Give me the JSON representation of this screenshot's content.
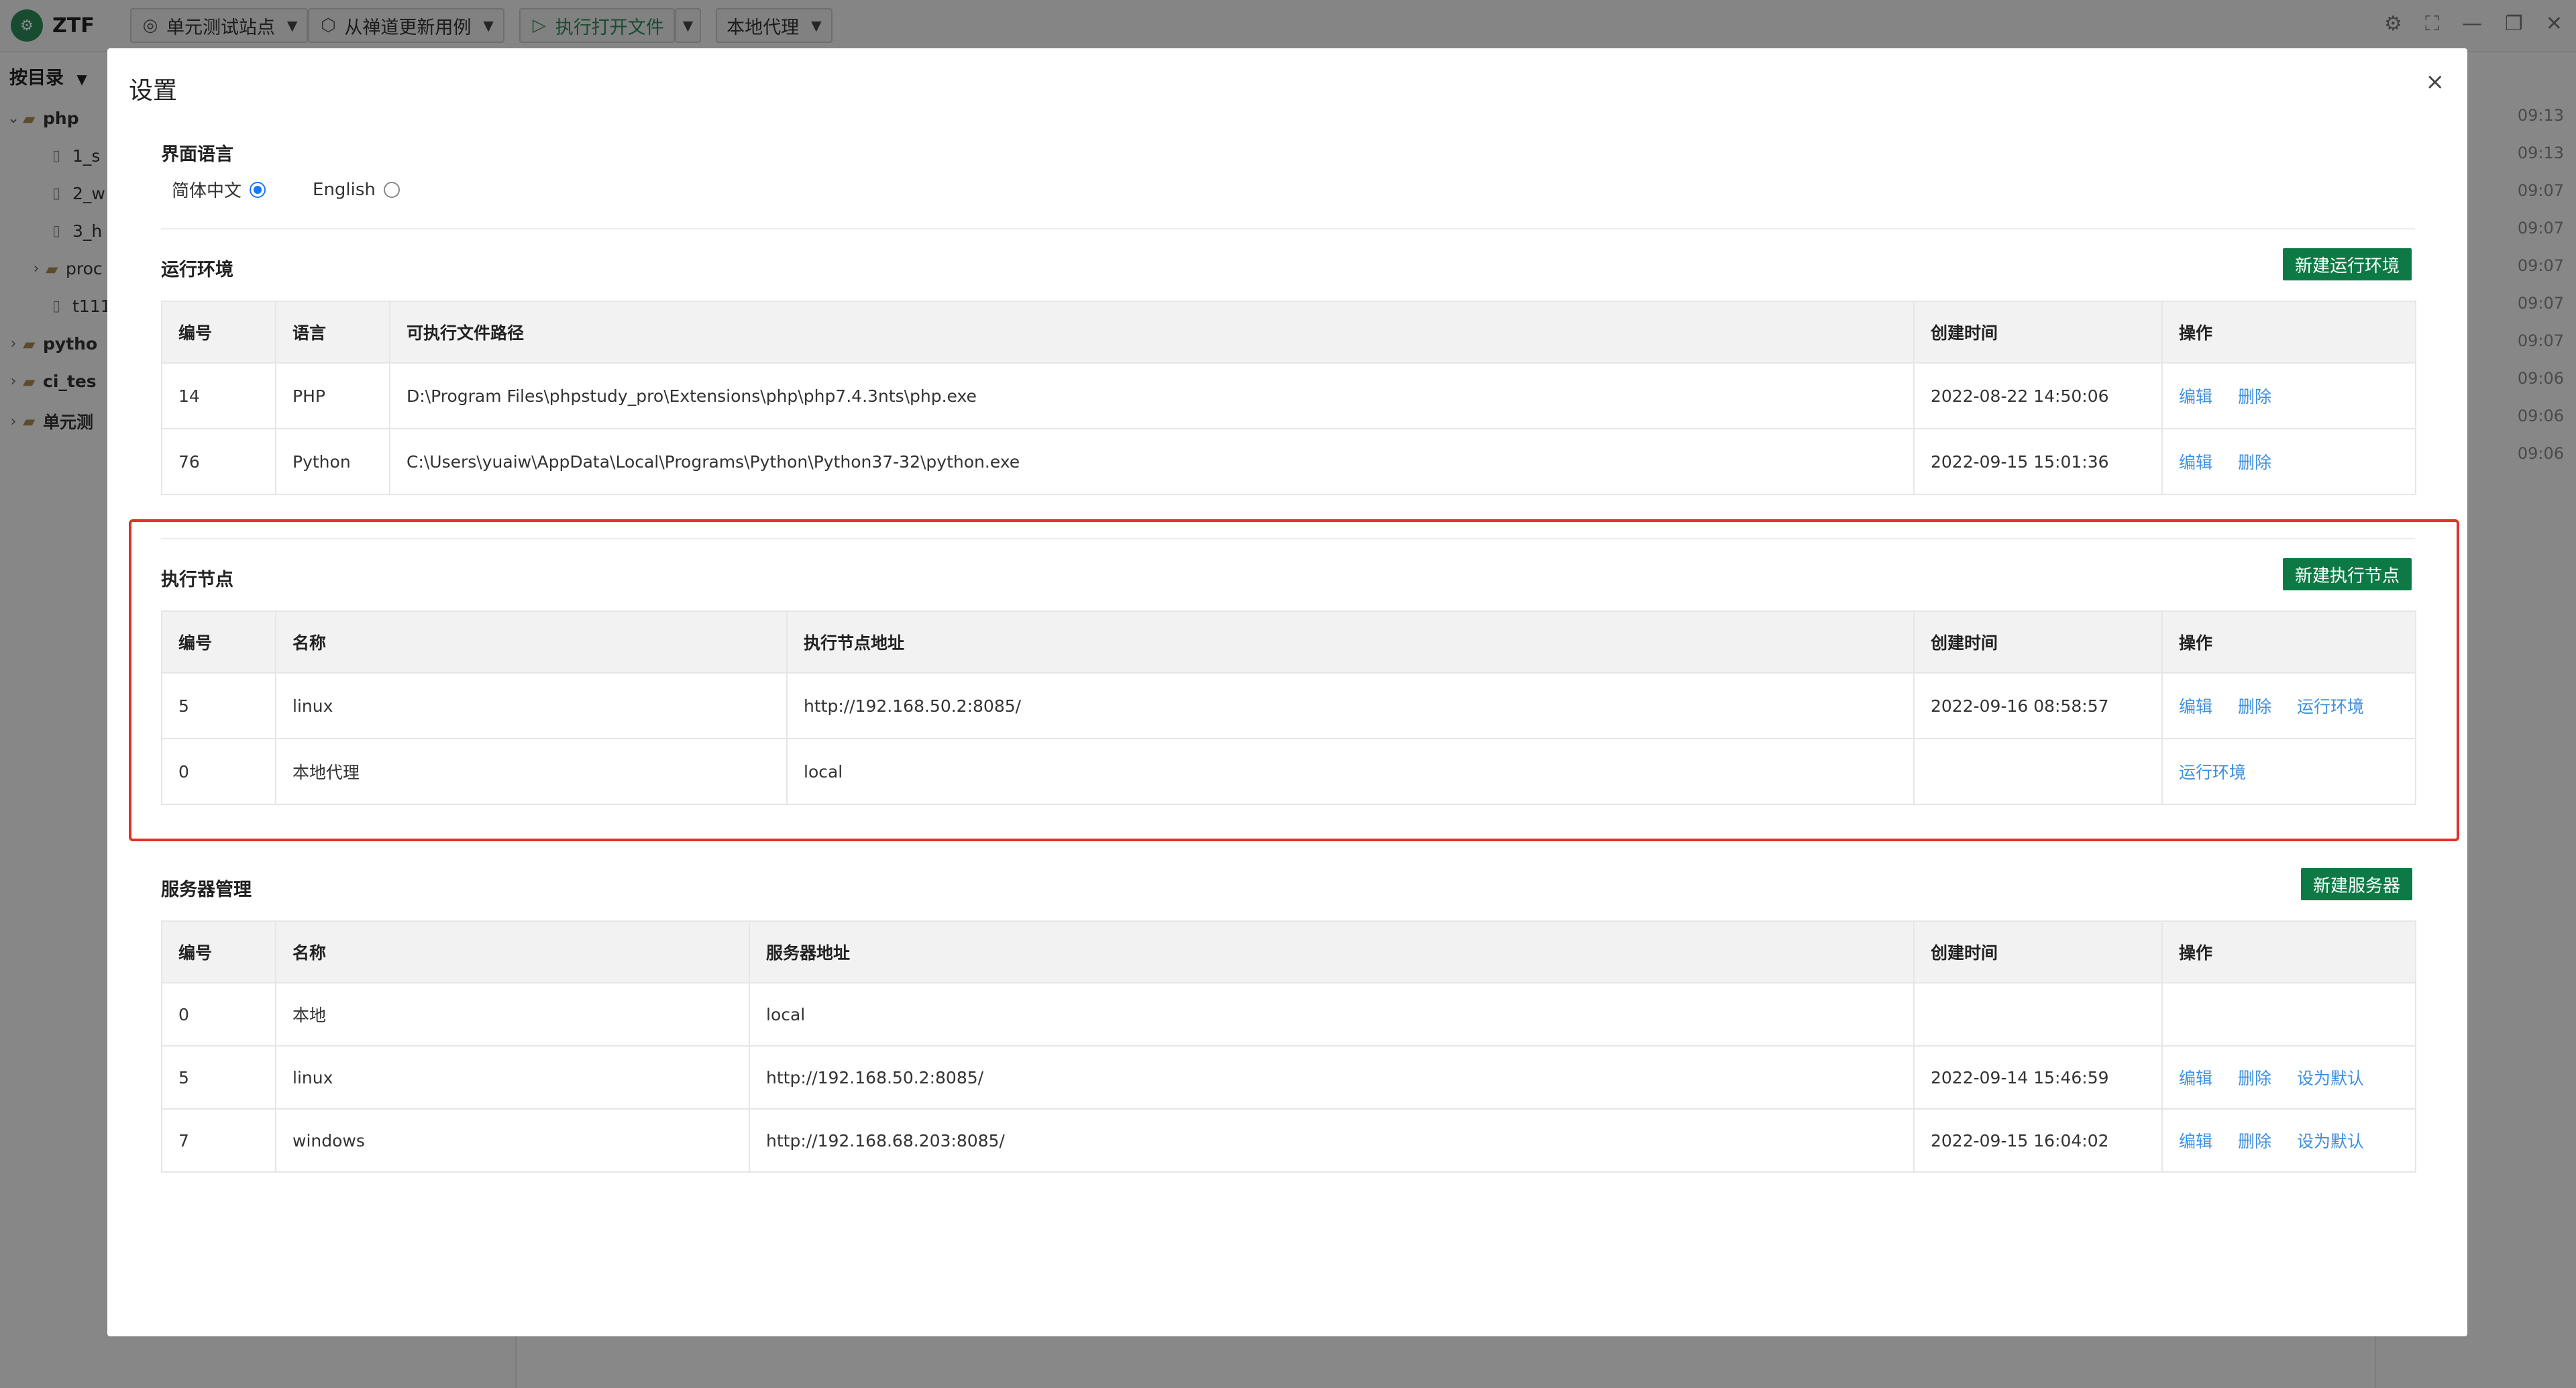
{
  "app": {
    "name": "ZTF",
    "toolbar": {
      "site": "单元测试站点",
      "update": "从禅道更新用例",
      "run": "执行打开文件",
      "agent": "本地代理"
    },
    "sidebar": {
      "title": "按目录",
      "items": [
        {
          "label": "php",
          "kind": "folder",
          "expanded": true
        },
        {
          "label": "1_s",
          "kind": "file"
        },
        {
          "label": "2_w",
          "kind": "file"
        },
        {
          "label": "3_h",
          "kind": "file"
        },
        {
          "label": "proc",
          "kind": "folder",
          "expanded": false
        },
        {
          "label": "t111",
          "kind": "file"
        },
        {
          "label": "pytho",
          "kind": "folder",
          "expanded": false
        },
        {
          "label": "ci_tes",
          "kind": "folder",
          "expanded": false
        },
        {
          "label": "单元测",
          "kind": "folder",
          "expanded": false
        }
      ]
    },
    "times": [
      "09:13",
      "09:13",
      "09:07",
      "09:07",
      "09:07",
      "09:07",
      "09:07",
      "09:06",
      "09:06",
      "09:06"
    ]
  },
  "modal": {
    "title": "设置",
    "close": "×",
    "language": {
      "title": "界面语言",
      "options": [
        {
          "label": "简体中文",
          "selected": true
        },
        {
          "label": "English",
          "selected": false
        }
      ]
    },
    "runtime": {
      "title": "运行环境",
      "new_button": "新建运行环境",
      "columns": [
        "编号",
        "语言",
        "可执行文件路径",
        "创建时间",
        "操作"
      ],
      "rows": [
        {
          "id": "14",
          "lang": "PHP",
          "path": "D:\\Program Files\\phpstudy_pro\\Extensions\\php\\php7.4.3nts\\php.exe",
          "created": "2022-08-22 14:50:06",
          "ops": [
            "编辑",
            "删除"
          ]
        },
        {
          "id": "76",
          "lang": "Python",
          "path": "C:\\Users\\yuaiw\\AppData\\Local\\Programs\\Python\\Python37-32\\python.exe",
          "created": "2022-09-15 15:01:36",
          "ops": [
            "编辑",
            "删除"
          ]
        }
      ]
    },
    "nodes": {
      "title": "执行节点",
      "new_button": "新建执行节点",
      "columns": [
        "编号",
        "名称",
        "执行节点地址",
        "创建时间",
        "操作"
      ],
      "rows": [
        {
          "id": "5",
          "name": "linux",
          "addr": "http://192.168.50.2:8085/",
          "created": "2022-09-16 08:58:57",
          "ops": [
            "编辑",
            "删除",
            "运行环境"
          ]
        },
        {
          "id": "0",
          "name": "本地代理",
          "addr": "local",
          "created": "",
          "ops": [
            "运行环境"
          ]
        }
      ]
    },
    "servers": {
      "title": "服务器管理",
      "new_button": "新建服务器",
      "columns": [
        "编号",
        "名称",
        "服务器地址",
        "创建时间",
        "操作"
      ],
      "rows": [
        {
          "id": "0",
          "name": "本地",
          "addr": "local",
          "created": "",
          "ops": []
        },
        {
          "id": "5",
          "name": "linux",
          "addr": "http://192.168.50.2:8085/",
          "created": "2022-09-14 15:46:59",
          "ops": [
            "编辑",
            "删除",
            "设为默认"
          ]
        },
        {
          "id": "7",
          "name": "windows",
          "addr": "http://192.168.68.203:8085/",
          "created": "2022-09-15 16:04:02",
          "ops": [
            "编辑",
            "删除",
            "设为默认"
          ]
        }
      ]
    }
  },
  "colors": {
    "primary_green": "#0d7a45",
    "link_blue": "#3d8fe0",
    "highlight_red": "#e0322a",
    "radio_blue": "#1677ff"
  }
}
